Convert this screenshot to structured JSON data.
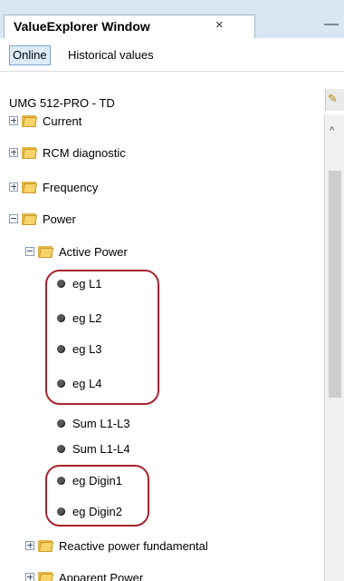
{
  "window": {
    "title": "ValueExplorer Window",
    "close_glyph": "×",
    "minimize_glyph": "—"
  },
  "toolbar": {
    "online_label": "Online",
    "historical_label": "Historical values"
  },
  "device": {
    "name": "UMG 512-PRO - TD"
  },
  "tree": {
    "current": "Current",
    "rcm": "RCM diagnostic",
    "frequency": "Frequency",
    "power": "Power",
    "active_power": "Active Power",
    "leaves": [
      "eg L1",
      "eg L2",
      "eg L3",
      "eg L4",
      "Sum L1-L3",
      "Sum L1-L4",
      "eg Digin1",
      "eg Digin2"
    ],
    "reactive": "Reactive power fundamental",
    "apparent": "Apparent Power"
  },
  "colors": {
    "highlight": "#a8232e",
    "tab_background": "#d9e7f4",
    "active_button": "#dcebf9"
  }
}
